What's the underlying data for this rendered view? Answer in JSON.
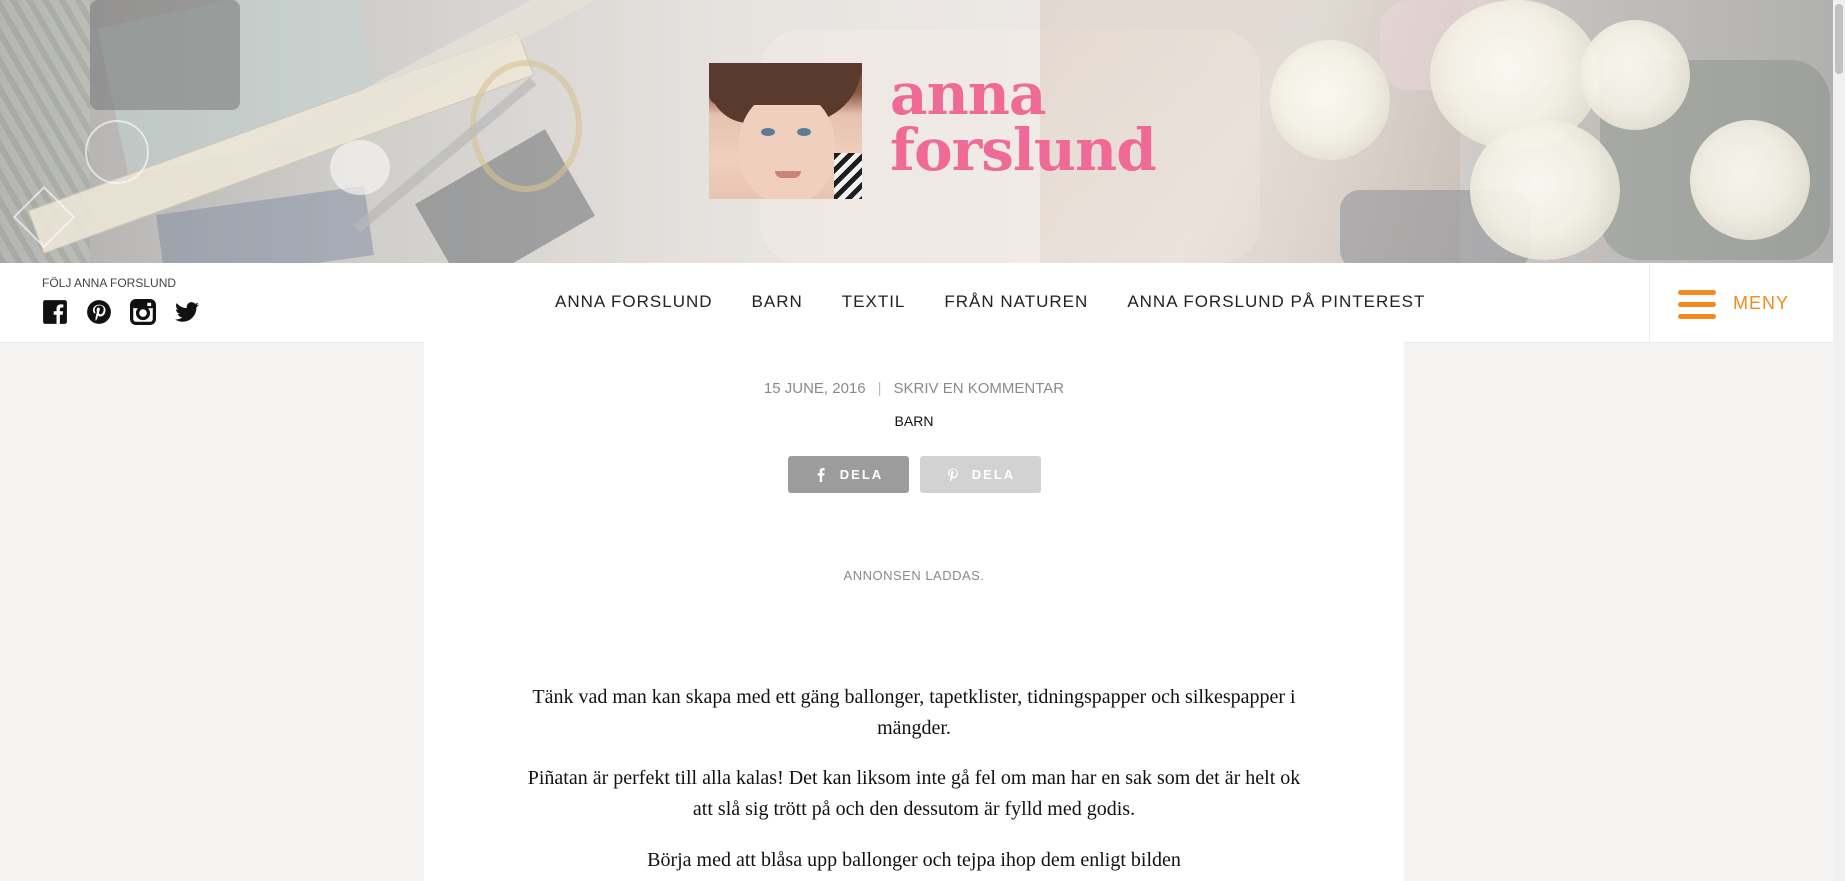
{
  "header": {
    "brand_line1": "anna",
    "brand_line2": "forslund",
    "colors": {
      "brand_pink": "#f06a98"
    }
  },
  "navbar": {
    "follow_label": "FÖLJ ANNA FORSLUND",
    "social_icons": [
      "facebook-icon",
      "pinterest-icon",
      "instagram-icon",
      "twitter-icon"
    ],
    "items": [
      {
        "label": "ANNA FORSLUND"
      },
      {
        "label": "BARN"
      },
      {
        "label": "TEXTIL"
      },
      {
        "label": "FRÅN NATUREN"
      },
      {
        "label": "ANNA FORSLUND PÅ PINTEREST"
      }
    ],
    "menu_label": "MENY",
    "colors": {
      "menu_accent": "#f58a1f"
    }
  },
  "post": {
    "date": "15 JUNE, 2016",
    "separator": "|",
    "comment_link": "SKRIV EN KOMMENTAR",
    "category": "BARN",
    "share_facebook": "DELA",
    "share_pinterest": "DELA",
    "ad_loading": "ANNONSEN LADDAS.",
    "paragraphs": [
      "Tänk vad man kan skapa med ett gäng ballonger, tapetklister, tidningspapper och silkespapper i mängder.",
      "Piñatan är perfekt till alla kalas! Det kan liksom inte gå fel om man har en sak som det är helt ok att slå sig trött på och den dessutom är fylld med godis.",
      "Börja med att blåsa upp ballonger och tejpa ihop dem enligt bilden"
    ]
  }
}
